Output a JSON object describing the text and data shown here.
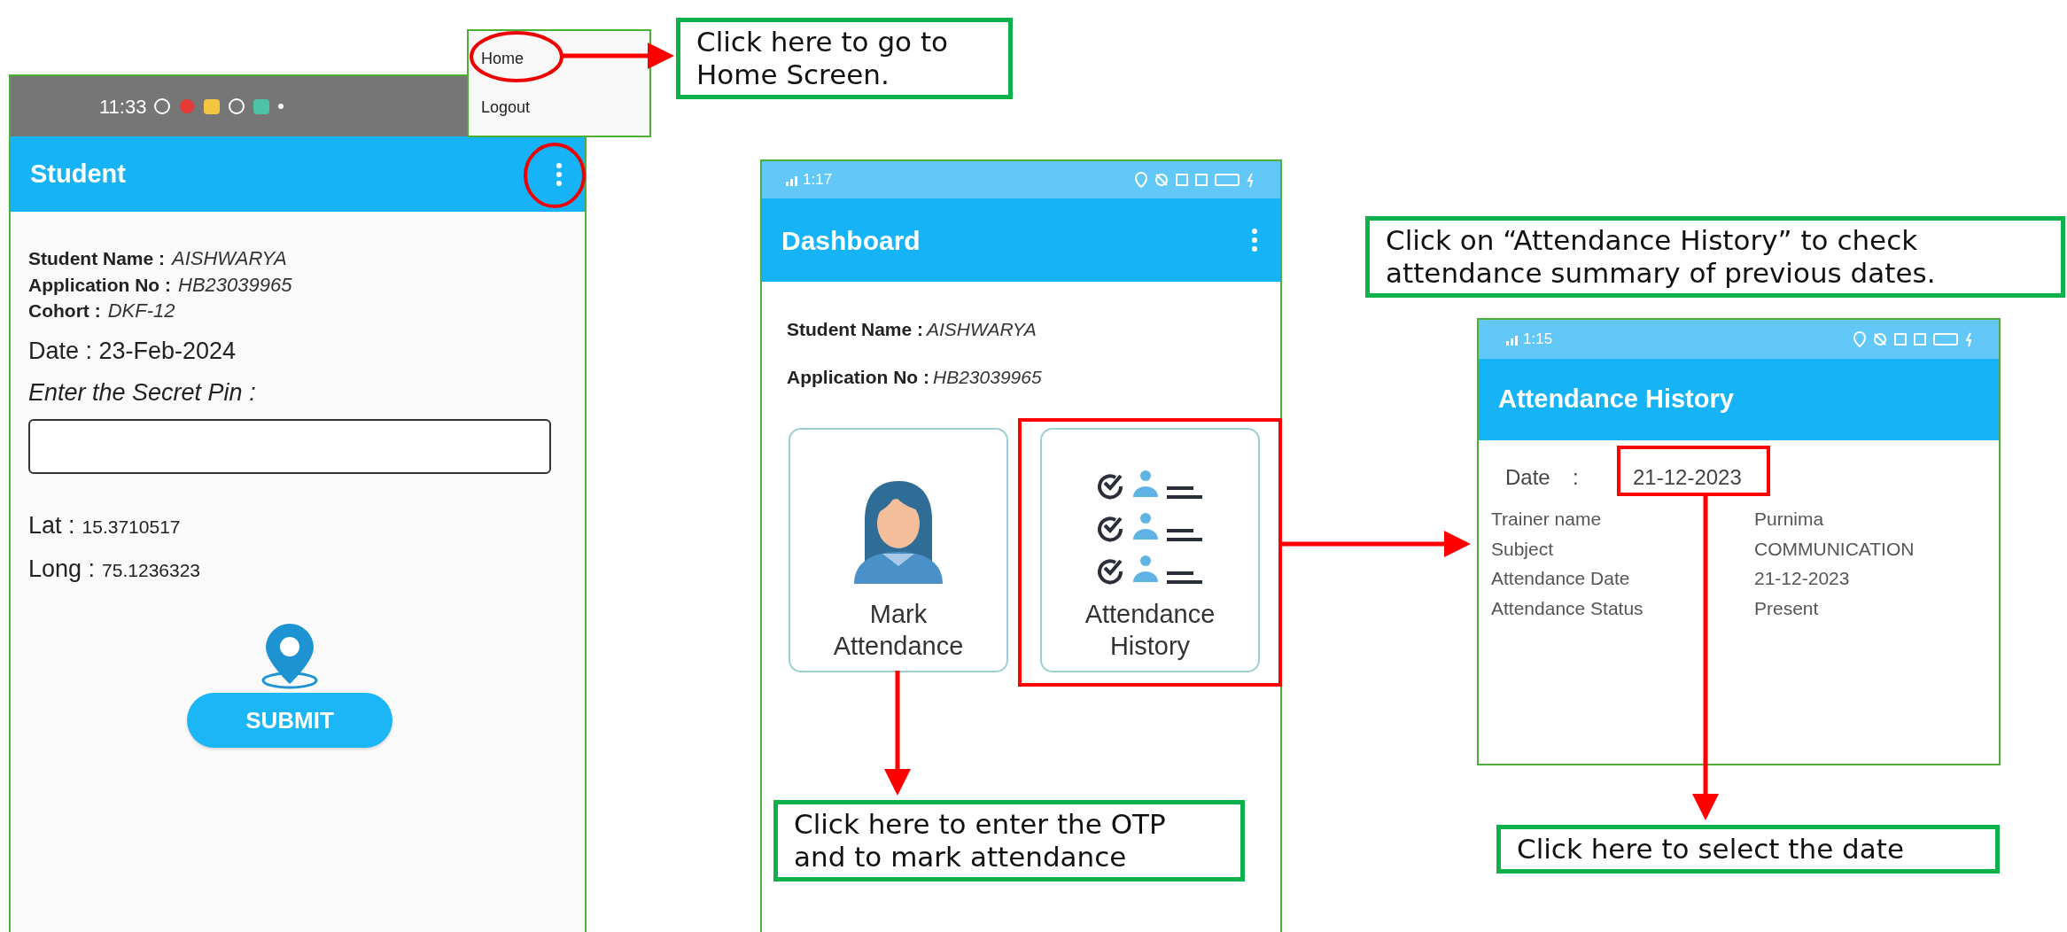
{
  "student_screen": {
    "status_time": "11:33",
    "title": "Student",
    "fields": [
      {
        "label": "Student Name :",
        "value": "AISHWARYA"
      },
      {
        "label": "Application No :",
        "value": "HB23039965"
      },
      {
        "label": "Cohort :",
        "value": "DKF-12"
      }
    ],
    "date_text": "Date : 23-Feb-2024",
    "pin_label": "Enter the Secret Pin :",
    "coords": [
      {
        "label": "Lat :",
        "value": "15.3710517"
      },
      {
        "label": "Long :",
        "value": "75.1236323"
      }
    ],
    "submit": "SUBMIT"
  },
  "menu": {
    "items": [
      {
        "label": "Home"
      },
      {
        "label": "Logout"
      }
    ]
  },
  "dashboard_screen": {
    "status_time": "1:17",
    "title": "Dashboard",
    "fields": [
      {
        "label": "Student Name :",
        "value": "AISHWARYA"
      },
      {
        "label": "Application No :",
        "value": "HB23039965"
      }
    ],
    "tiles": [
      {
        "kind": "person",
        "label": "Mark Attendance"
      },
      {
        "kind": "history",
        "label": "Attendance History"
      }
    ]
  },
  "history_screen": {
    "status_time": "1:15",
    "title": "Attendance History",
    "date_label": "Date",
    "date_separator": ":",
    "date_value": "21-12-2023",
    "rows": [
      {
        "label": "Trainer name",
        "value": "Purnima"
      },
      {
        "label": "Subject",
        "value": "COMMUNICATION"
      },
      {
        "label": "Attendance Date",
        "value": "21-12-2023"
      },
      {
        "label": "Attendance Status",
        "value": "Present"
      }
    ]
  },
  "callouts": [
    {
      "text": "Click here to go to Home Screen."
    },
    {
      "text": "Click on “Attendance History” to check attendance summary of previous dates."
    },
    {
      "text": "Click here to enter the OTP and to mark attendance"
    },
    {
      "text": "Click here to select the date"
    }
  ]
}
